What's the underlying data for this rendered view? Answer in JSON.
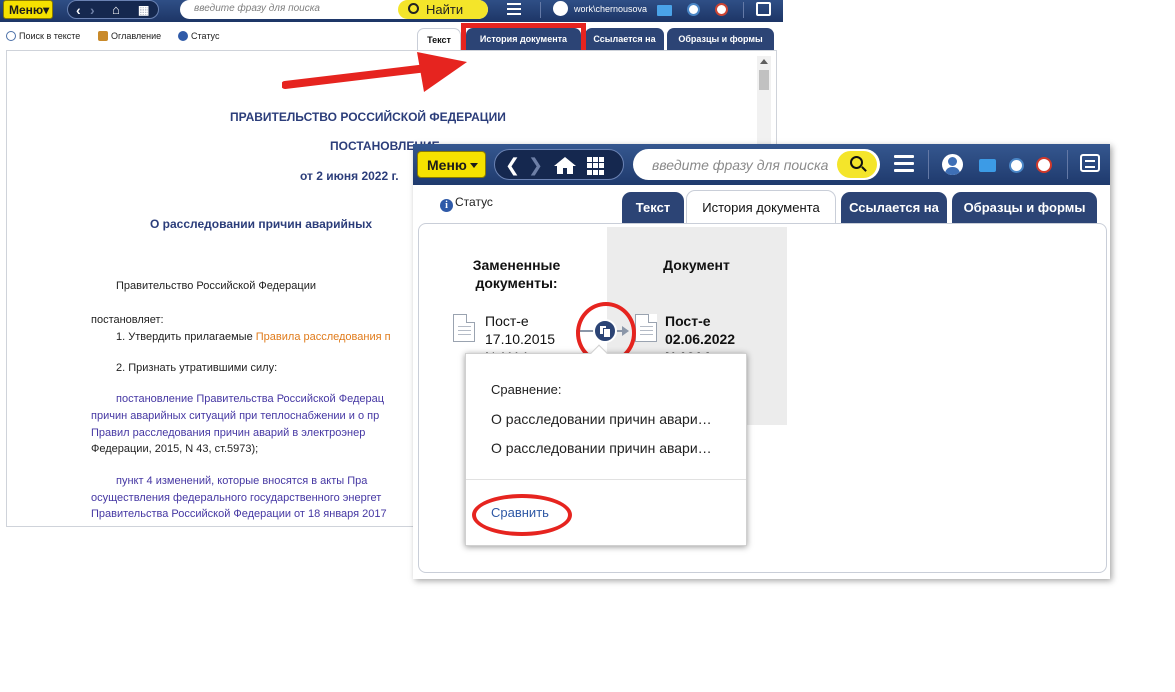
{
  "colors": {
    "topbar": "#1d3566",
    "menu_yellow": "#f5e100",
    "tab_blue": "#2c4475",
    "annotation_red": "#e6241f",
    "link_orange": "#e07b1b",
    "link_purple": "#4537a3",
    "action_blue": "#2e58a5"
  },
  "bg_window": {
    "header": {
      "menu_label": "Меню",
      "search_placeholder": "введите фразу для поиска",
      "search_button": "Найти",
      "user_name": "work\\chernousova"
    },
    "toolbar": {
      "search_in_text": "Поиск в тексте",
      "contents": "Оглавление",
      "status": "Статус"
    },
    "tabs": [
      {
        "label": "Текст"
      },
      {
        "label": "История документа"
      },
      {
        "label": "Ссылается на"
      },
      {
        "label": "Образцы и формы"
      }
    ],
    "document": {
      "heading_gov": "ПРАВИТЕЛЬСТВО РОССИЙСКОЙ ФЕДЕРАЦИИ",
      "heading_type": "ПОСТАНОВЛЕНИЕ",
      "heading_date": "от 2 июня 2022 г.",
      "heading_title": "О расследовании причин аварийных",
      "p_gov": "Правительство Российской Федерации",
      "p_decides": "постановляет:",
      "p_item1_prefix": "1. Утвердить прилагаемые",
      "p_item1_link": "Правила расследования п",
      "p_item2": "2. Признать утратившими силу:",
      "p_link1_line1": "постановление Правительства Российской Федерац",
      "p_link1_line2": "причин аварийных ситуаций при теплоснабжении и о пр",
      "p_link1_line3": "Правил  расследования  причин  аварий  в  электроэнер",
      "p_link1_line4": "Федерации, 2015, N 43, ст.5973);",
      "p_link2_line1": "пункт 4 изменений, которые вносятся в акты Пра",
      "p_link2_line2": "осуществления федерального государственного энергет",
      "p_link2_line3": "Правительства Российской Федерации от 18 января 2017"
    }
  },
  "fg_window": {
    "header": {
      "menu_label": "Меню",
      "search_placeholder": "введите фразу для поиска"
    },
    "status": "Статус",
    "tabs": [
      {
        "label": "Текст"
      },
      {
        "label": "История документа"
      },
      {
        "label": "Ссылается на"
      },
      {
        "label": "Образцы и формы"
      }
    ],
    "history": {
      "replaced_header_l1": "Замененные",
      "replaced_header_l2": "документы:",
      "document_header": "Документ",
      "replaced_doc": {
        "l1": "Пост-е",
        "l2": "17.10.2015",
        "l3": "N 1114"
      },
      "current_doc": {
        "l1": "Пост-е",
        "l2": "02.06.2022",
        "l3": "N 1014"
      }
    },
    "popup": {
      "title": "Сравнение:",
      "item1": "О расследовании причин авари…",
      "item2": "О расследовании причин авари…",
      "button": "Сравнить"
    }
  }
}
